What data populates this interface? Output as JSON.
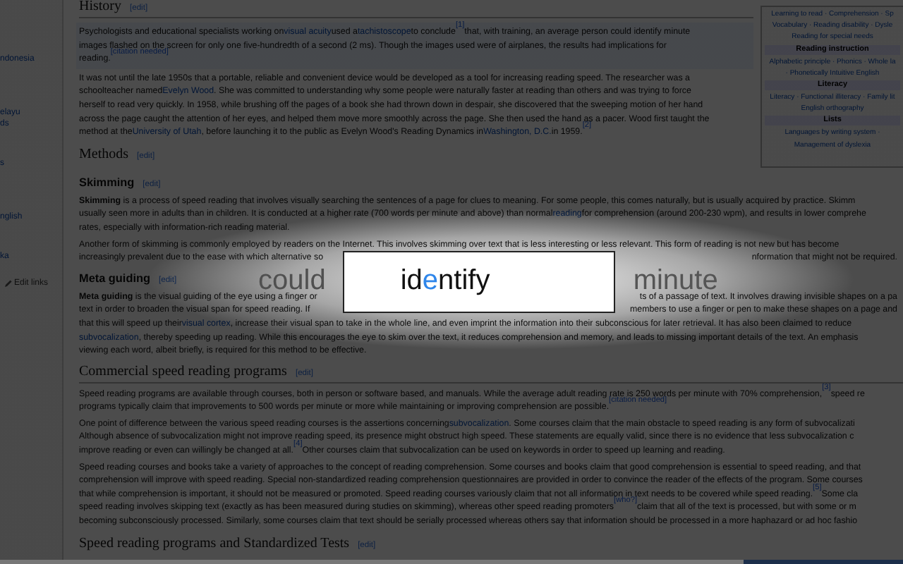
{
  "sidebar": {
    "items": [
      {
        "kind": "link",
        "label": "ndonesia"
      },
      {
        "kind": "link",
        "label": "elayu"
      },
      {
        "kind": "link",
        "label": "ds"
      },
      {
        "kind": "link",
        "label": "s"
      },
      {
        "kind": "link",
        "label": "nglish"
      },
      {
        "kind": "link",
        "label": "ka"
      },
      {
        "kind": "edit",
        "label": "Edit links"
      }
    ]
  },
  "article": {
    "top_blocks": [
      {
        "kind": "heading2",
        "text": "History",
        "edit_link": "[edit]"
      },
      {
        "kind": "paragraph",
        "highlighted": true,
        "lines": [
          {
            "segments": [
              "Psychologists and educational specialists working on ",
              {
                "kind": "link",
                "text": "visual acuity"
              },
              " used a ",
              {
                "kind": "link",
                "text": "tachistoscope"
              },
              " to conclude",
              {
                "kind": "ref",
                "text": "[1]"
              },
              " that, with training, an average person could identify minute"
            ]
          },
          {
            "segments": [
              "images flashed on the screen for only one five-hundredth of a second (2 ms). Though the images used were of airplanes, the results had implications for"
            ]
          },
          {
            "segments": [
              "reading.",
              {
                "kind": "ref",
                "text": "[citation needed]"
              }
            ]
          }
        ]
      },
      {
        "kind": "paragraph",
        "highlighted": false,
        "lines": [
          {
            "segments": [
              "It was not until the late 1950s that a portable, reliable and convenient device would be developed as a tool for increasing reading speed. The researcher was a"
            ]
          },
          {
            "segments": [
              "schoolteacher named ",
              {
                "kind": "link",
                "text": "Evelyn Wood"
              },
              ". She was committed to understanding why some people were naturally faster at reading than others and was trying to force"
            ]
          },
          {
            "segments": [
              "herself to read very quickly. In 1958, while brushing off the pages of a book she had thrown down in despair, she discovered that the sweeping motion of her hand"
            ]
          },
          {
            "segments": [
              "across the page caught the attention of her eyes, and helped them move more smoothly across the page. She then used the hand as a pacer. Wood first taught the"
            ]
          },
          {
            "segments": [
              "method at the ",
              {
                "kind": "link",
                "text": "University of Utah"
              },
              ", before launching it to the public as Evelyn Wood's Reading Dynamics in ",
              {
                "kind": "link",
                "text": "Washington, D.C."
              },
              " in 1959.",
              {
                "kind": "ref",
                "text": "[2]"
              }
            ]
          }
        ]
      },
      {
        "kind": "heading2",
        "text": "Methods",
        "edit_link": "[edit]"
      }
    ],
    "infobox": {
      "rows": [
        {
          "kind": "links",
          "text": "Learning to read · Comprehension · Sp"
        },
        {
          "kind": "links",
          "text": "Vocabulary · Reading disability · Dysle"
        },
        {
          "kind": "links",
          "text": "Reading for special needs"
        },
        {
          "kind": "header",
          "text": "Reading instruction"
        },
        {
          "kind": "links",
          "text": "Alphabetic principle · Phonics · Whole la"
        },
        {
          "kind": "links",
          "text": "· Phonetically Intuitive English"
        },
        {
          "kind": "header",
          "text": "Literacy"
        },
        {
          "kind": "links",
          "text": "Literacy · Functional illiteracy · Family lit"
        },
        {
          "kind": "links",
          "text": "English orthography"
        },
        {
          "kind": "header",
          "text": "Lists"
        },
        {
          "kind": "links",
          "text": "Languages by writing system ·"
        },
        {
          "kind": "links",
          "text": "Management of dyslexia"
        }
      ]
    },
    "blocks": [
      {
        "kind": "heading3",
        "text": "Skimming",
        "edit_link": "[edit]"
      },
      {
        "kind": "paragraph",
        "highlighted": false,
        "lines": [
          {
            "segments": [
              "**Skimming** is a process of speed reading that involves visually searching the sentences of a page for clues to meaning. For some people, this comes naturally, but is usually acquired by practice. Skimm"
            ]
          },
          {
            "segments": [
              "usually seen more in adults than in children. It is conducted at a higher rate (700 words per minute and above) than normal ",
              {
                "kind": "link",
                "text": "reading"
              },
              " for comprehension (around 200-230 wpm), and results in lower comprehe"
            ]
          },
          {
            "segments": [
              "rates, especially with information-rich reading material."
            ]
          }
        ]
      },
      {
        "kind": "paragraph",
        "highlighted": false,
        "lines": [
          {
            "segments": [
              "Another form of skimming is commonly employed by readers on the Internet. This involves skimming over text that is less interesting or less relevant. This form of reading is not new but has become"
            ]
          },
          {
            "left": [
              "increasingly prevalent due to the ease with which alternative so"
            ],
            "right": [
              "nformation that might not be required."
            ]
          }
        ]
      },
      {
        "kind": "heading3",
        "text": "Meta guiding",
        "edit_link": "[edit]"
      },
      {
        "kind": "paragraph",
        "highlighted": false,
        "lines": [
          {
            "left": [
              "**Meta guiding** is the visual guiding of the eye using a finger or"
            ],
            "right": [
              "ts of a passage of text. It involves drawing invisible shapes on a pa"
            ]
          },
          {
            "left": [
              "text in order to broaden the visual span for speed reading. If"
            ],
            "right": [
              "members to use a finger or pen to make these shapes on a page and"
            ]
          },
          {
            "segments": [
              "that this will speed up their ",
              {
                "kind": "link",
                "text": "visual cortex"
              },
              ", increase their visual span to take in the whole line, and even imprint the information into their subconscious for later retrieval. It has also been claimed to reduce"
            ]
          },
          {
            "segments": [
              {
                "kind": "link",
                "text": "subvocalization"
              },
              ", thereby speeding up reading. While this encourages the eye to skim over the text, it reduces comprehension and memory, and leads to missing important details of the text. An emphasis"
            ]
          },
          {
            "segments": [
              "viewing each word, albeit briefly, is required for this method to be effective."
            ]
          }
        ]
      },
      {
        "kind": "heading2",
        "text": "Commercial speed reading programs",
        "edit_link": "[edit]"
      },
      {
        "kind": "paragraph",
        "highlighted": false,
        "lines": [
          {
            "segments": [
              "Speed reading programs are available through courses, both in person or software based, and manuals. While the average adult reading rate is 250 words per minute with 70% comprehension,",
              {
                "kind": "ref",
                "text": "[3]"
              },
              " speed re"
            ]
          },
          {
            "segments": [
              "programs typically claim that improvements to 500 words per minute or more while maintaining or improving comprehension are possible.",
              {
                "kind": "ref",
                "text": "[citation needed]"
              }
            ]
          }
        ]
      },
      {
        "kind": "paragraph",
        "highlighted": false,
        "lines": [
          {
            "segments": [
              "One point of difference between the various speed reading courses is the assertions concerning ",
              {
                "kind": "link",
                "text": "subvocalization"
              },
              ". Some courses claim that the main obstacle to speed reading is any form of subvocalizati"
            ]
          },
          {
            "segments": [
              "Although absence of subvocalization might not improve reading speed, its presence might obstruct high speed. These statements are equally valid, since there is no evidence that less subvocalization c"
            ]
          },
          {
            "segments": [
              "improve reading or even can willingly be changed at all.",
              {
                "kind": "ref",
                "text": "[4]"
              },
              " Other courses claim that subvocalization can be used on keywords in order to speed up learning and reading."
            ]
          }
        ]
      },
      {
        "kind": "paragraph",
        "highlighted": false,
        "lines": [
          {
            "segments": [
              "Speed reading courses and books take a variety of approaches to the concept of reading comprehension. Some courses and books claim that good comprehension is essential to speed reading, and that"
            ]
          },
          {
            "segments": [
              "comprehension will improve with speed reading. Special non-standardized reading comprehension questionnaires are provided in order to convince the reader of the effects of the program. Some courses"
            ]
          },
          {
            "segments": [
              "that while comprehension is important, it should not be measured or promoted. Speed reading courses variously claim that not all information in text needs to be covered while speed reading.",
              {
                "kind": "ref",
                "text": "[5]"
              },
              " Some cla"
            ]
          },
          {
            "segments": [
              "speed reading involves skipping text (exactly as has been measured during studies on skimming), whereas other speed reading promoters",
              {
                "kind": "ref",
                "text": "[who?]"
              },
              " claim that all of the text is processed, but with some or m"
            ]
          },
          {
            "segments": [
              "becoming subconsciously processed. Similarly, some courses claim that text should be serially processed whereas others say that information should be processed in a more haphazard or ad hoc fashio"
            ]
          }
        ]
      },
      {
        "kind": "heading2",
        "text": "Speed reading programs and Standardized Tests",
        "edit_link": "[edit]"
      }
    ]
  },
  "speed_reader": {
    "previous_word": "could",
    "current_word": {
      "before": "id",
      "focus": "e",
      "after": "ntify"
    },
    "next_word": "minute"
  }
}
